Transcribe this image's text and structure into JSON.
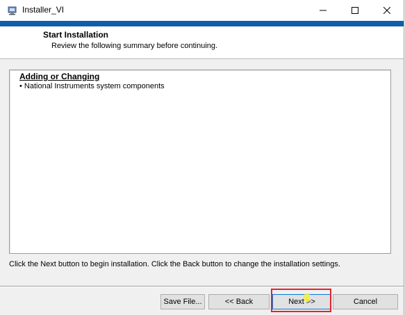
{
  "window": {
    "title": "Installer_VI",
    "accent_color": "#0c5fa8"
  },
  "header": {
    "title": "Start Installation",
    "subtitle": "Review the following summary before continuing."
  },
  "summary": {
    "heading": "Adding or Changing",
    "items": [
      "• National Instruments system components"
    ]
  },
  "instruction": "Click the Next button to begin installation.  Click the Back button to change the installation settings.",
  "buttons": {
    "save_file": "Save File...",
    "back": "<< Back",
    "next": "Next >>",
    "cancel": "Cancel"
  },
  "annotation": {
    "highlight_color": "#e0242f"
  }
}
